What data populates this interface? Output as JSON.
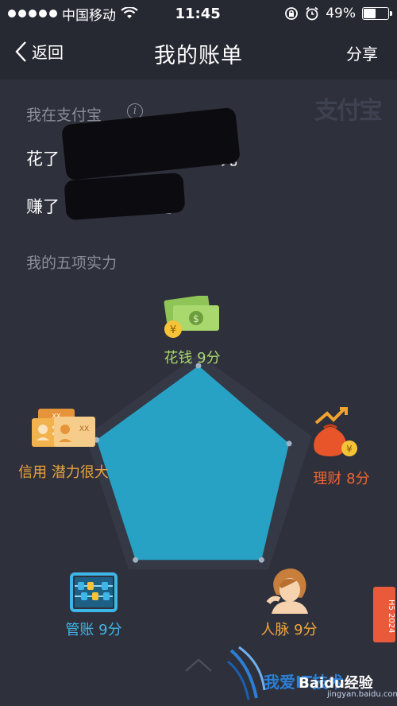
{
  "status_bar": {
    "carrier": "中国移动",
    "time": "11:45",
    "battery": "49%",
    "battery_level": 0.49
  },
  "nav": {
    "back_label": "返回",
    "title": "我的账单",
    "share_label": "分享"
  },
  "summary": {
    "section_label": "我在支付宝",
    "info_icon": "i",
    "brand_mark": "支付宝",
    "spent_prefix": "花了",
    "spent_suffix": "元",
    "earned_prefix": "赚了",
    "earned_suffix": "元"
  },
  "strengths": {
    "section_label": "我的五项实力",
    "dimensions": [
      {
        "name": "spending",
        "label": "花钱 9分",
        "color": "#a9d86e",
        "score": 9
      },
      {
        "name": "finance",
        "label": "理财 8分",
        "color": "#f0652f",
        "score": 8
      },
      {
        "name": "network",
        "label": "人脉 9分",
        "color": "#f2a63c",
        "score": 9
      },
      {
        "name": "bookkeeping",
        "label": "管账 9分",
        "color": "#3fb6e8",
        "score": 9
      },
      {
        "name": "credit",
        "label": "信用 潜力很大",
        "color": "#e8a33c",
        "score": 9
      }
    ],
    "max_score": 10,
    "fill_color": "#28a2c4"
  },
  "watermark": {
    "text": "我爱IT技术",
    "baidu": "Baidu经验",
    "url": "jingyan.baidu.com",
    "tag": "H5 2024"
  }
}
